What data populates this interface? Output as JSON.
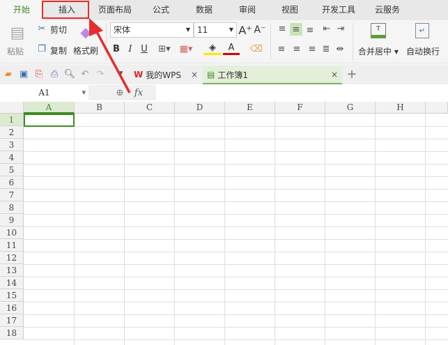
{
  "menu_tabs": [
    "开始",
    "插入",
    "页面布局",
    "公式",
    "数据",
    "审阅",
    "视图",
    "开发工具",
    "云服务"
  ],
  "ribbon": {
    "paste": "粘贴",
    "cut": "剪切",
    "copy": "复制",
    "format_painter": "格式刷",
    "font_name": "宋体",
    "font_size": "11",
    "bold": "B",
    "italic": "I",
    "underline": "U",
    "merge_center": "合并居中",
    "wrap_text": "自动换行"
  },
  "doc_tabs": {
    "my_wps": "我的WPS",
    "workbook": "工作簿1"
  },
  "formula_bar": {
    "cell_ref": "A1",
    "fx": "fx"
  },
  "columns": [
    "A",
    "B",
    "C",
    "D",
    "E",
    "F",
    "G",
    "H"
  ],
  "rows": [
    "1",
    "2",
    "3",
    "4",
    "5",
    "6",
    "7",
    "8",
    "9",
    "10",
    "11",
    "12",
    "13",
    "14",
    "15",
    "16",
    "17",
    "18"
  ],
  "colors": {
    "accent": "#3d8b1f",
    "highlight": "#e52d2d"
  }
}
